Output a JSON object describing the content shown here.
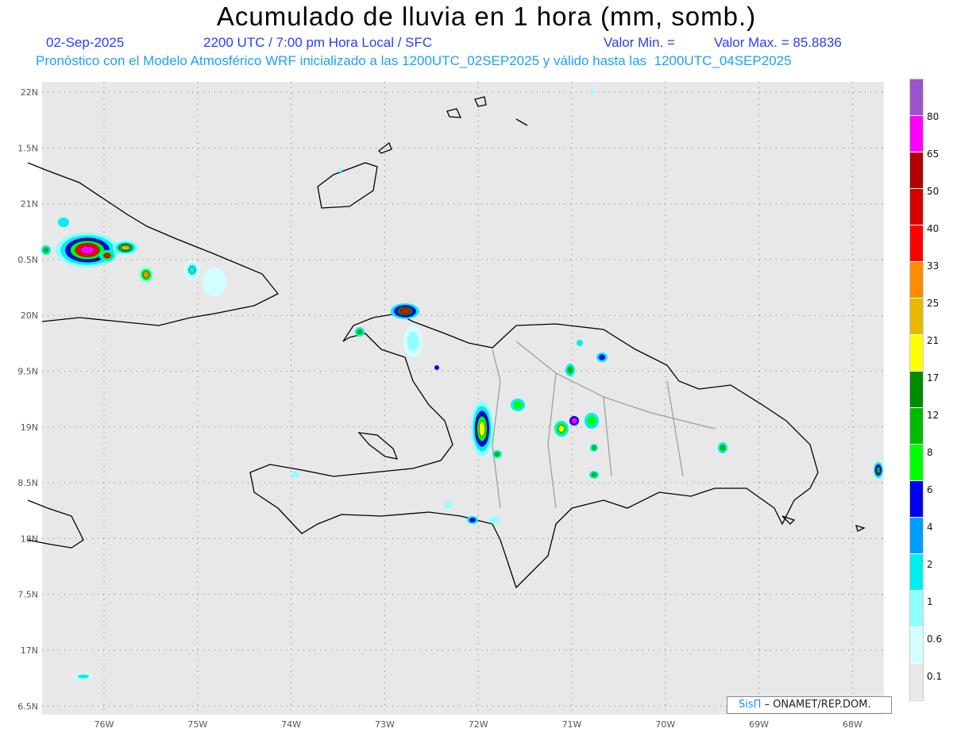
{
  "title": "Acumulado de lluvia en 1 hora (mm, somb.)",
  "date": "02-Sep-2025",
  "time": "2200 UTC / 7:00 pm Hora Local / SFC",
  "valor_min": "Valor Min. =",
  "valor_max": "Valor Max. = 85.8836",
  "model_line": "Pronóstico con el Modelo Atmosférico WRF inicializado a las 1200UTC_02SEP2025 y válido hasta las  1200UTC_04SEP2025",
  "lat_labels": [
    "22N",
    "1.5N",
    "21N",
    "0.5N",
    "20N",
    "9.5N",
    "19N",
    "8.5N",
    "18N",
    "7.5N",
    "17N",
    "6.5N"
  ],
  "lon_labels": [
    "76W",
    "75W",
    "74W",
    "73W",
    "72W",
    "71W",
    "70W",
    "69W",
    "68W"
  ],
  "colorbar": {
    "colors": [
      "#9b55c9",
      "#ff00ff",
      "#b00000",
      "#d60000",
      "#ff0000",
      "#ff8c00",
      "#e6b800",
      "#ffff00",
      "#008a00",
      "#00bb00",
      "#00ff00",
      "#0000ee",
      "#009cff",
      "#00eeee",
      "#90ffff",
      "#d2ffff",
      "#e8e8e8"
    ],
    "labels": [
      "80",
      "65",
      "50",
      "40",
      "33",
      "25",
      "21",
      "17",
      "12",
      "8",
      "6",
      "4",
      "2",
      "1",
      "0.6",
      "0.1"
    ]
  },
  "credit": {
    "logo": "SisΠ",
    "text": "– ONAMET/REP.DOM."
  }
}
